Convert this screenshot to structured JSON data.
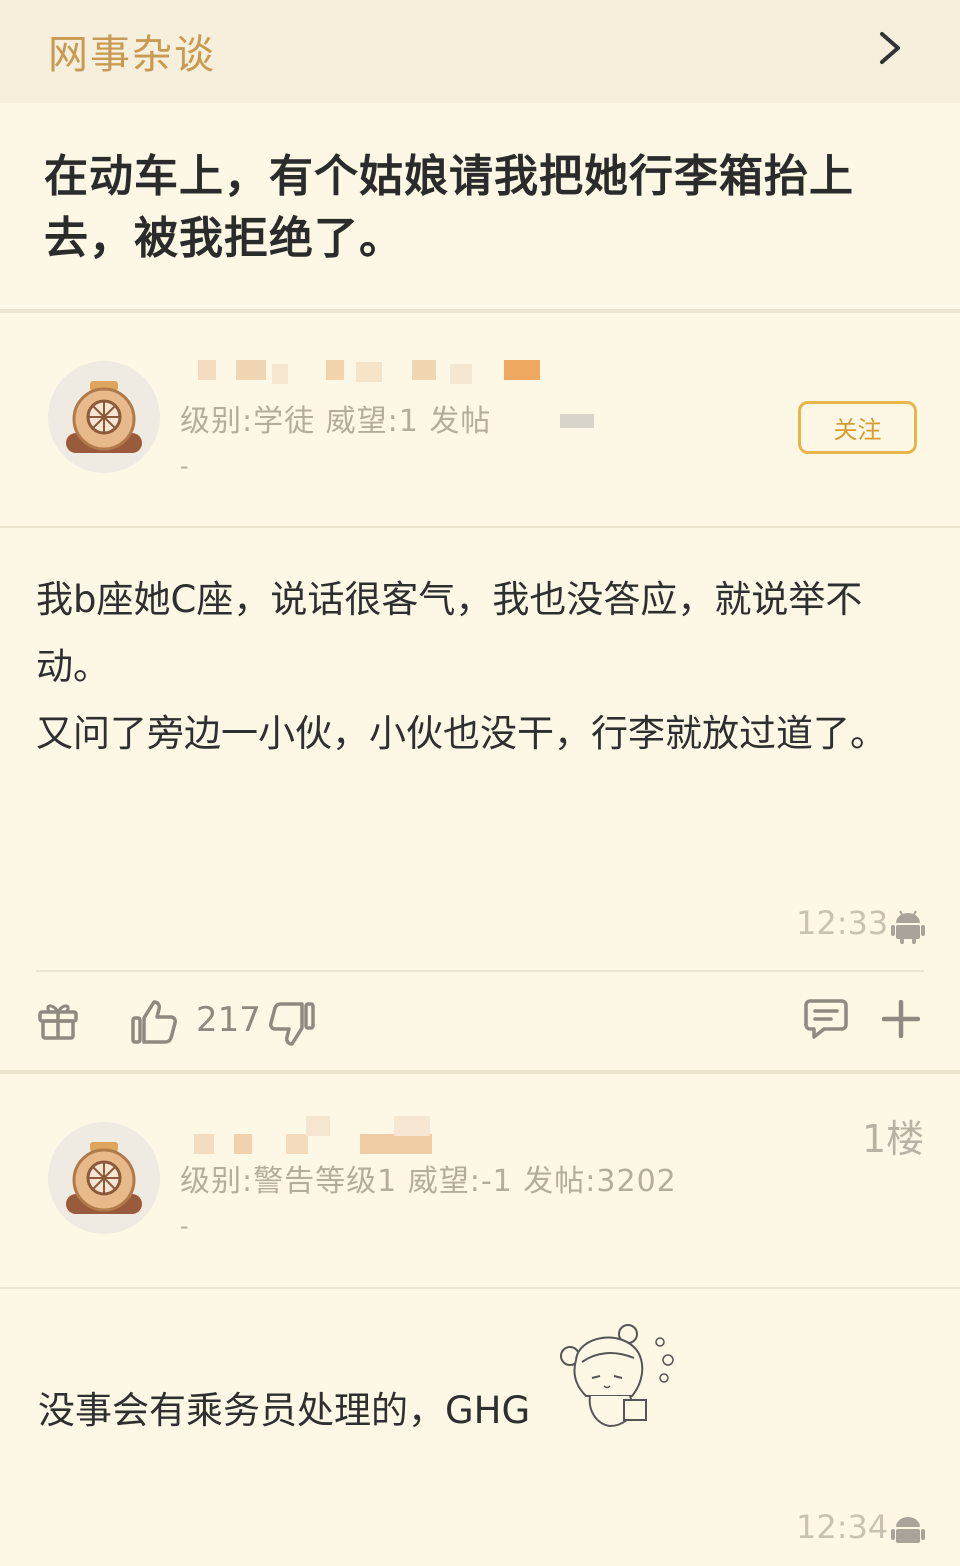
{
  "header": {
    "forum_name": "网事杂谈",
    "chevron_icon": "chevron-right-icon"
  },
  "thread": {
    "title": "在动车上，有个姑娘请我把她行李箱抬上去，被我拒绝了。"
  },
  "op": {
    "meta": "级别:学徒 威望:1 发帖",
    "dash": "-",
    "follow_label": "关注",
    "body_lines": [
      "我b座她C座，说话很客气，我也没答应，就说举不动。",
      "又问了旁边一小伙，小伙也没干，行李就放过道了。"
    ],
    "time": "12:33",
    "platform_icon": "android-icon"
  },
  "actions": {
    "gift_icon": "gift-icon",
    "like_icon": "thumbs-up-icon",
    "like_count": "217",
    "dislike_icon": "thumbs-down-icon",
    "comment_icon": "comment-icon",
    "more_icon": "plus-icon"
  },
  "reply": {
    "floor": "1楼",
    "meta": "级别:警告等级1 威望:-1 发帖:3202",
    "dash": "-",
    "body": "没事会有乘务员处理的，GHG",
    "time": "12:34"
  },
  "colors": {
    "background": "#fdf8e6",
    "header_bg": "#f5efdb",
    "accent": "#c99a54",
    "follow_border": "#e8b54b",
    "muted": "#b5ad9c"
  }
}
